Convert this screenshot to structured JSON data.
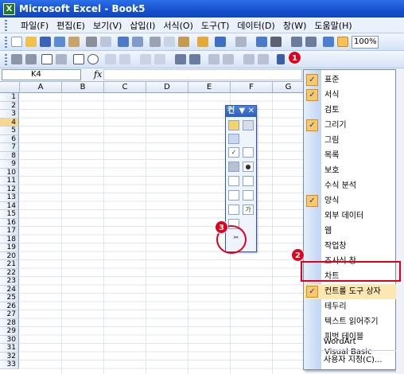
{
  "app": {
    "title": "Microsoft Excel - Book5",
    "icon": "excel-icon"
  },
  "menubar": {
    "items": [
      "파일(F)",
      "편집(E)",
      "보기(V)",
      "삽입(I)",
      "서식(O)",
      "도구(T)",
      "데이터(D)",
      "창(W)",
      "도움말(H)"
    ]
  },
  "toolbar": {
    "zoom": "100%"
  },
  "formula": {
    "name_box": "K4",
    "fx": "fx"
  },
  "columns": [
    "A",
    "B",
    "C",
    "D",
    "E",
    "F",
    "G"
  ],
  "rows": [
    "1",
    "2",
    "3",
    "4",
    "5",
    "6",
    "7",
    "8",
    "9",
    "10",
    "11",
    "12",
    "13",
    "14",
    "15",
    "16",
    "17",
    "18",
    "19",
    "20",
    "21",
    "22",
    "23",
    "24",
    "25",
    "26",
    "27",
    "28",
    "29",
    "30",
    "31",
    "32",
    "33"
  ],
  "control_toolbox": {
    "title": "컨",
    "title_controls": "▼ ✕",
    "button_ga": "가"
  },
  "dropdown": {
    "items": [
      {
        "label": "표준",
        "checked": true
      },
      {
        "label": "서식",
        "checked": true
      },
      {
        "label": "검토",
        "checked": false
      },
      {
        "label": "그리기",
        "checked": true
      },
      {
        "label": "그림",
        "checked": false
      },
      {
        "label": "목록",
        "checked": false
      },
      {
        "label": "보호",
        "checked": false
      },
      {
        "label": "수식 분석",
        "checked": false
      },
      {
        "label": "양식",
        "checked": true
      },
      {
        "label": "외부 데이터",
        "checked": false
      },
      {
        "label": "웹",
        "checked": false
      },
      {
        "label": "작업창",
        "checked": false
      },
      {
        "label": "조사식 창",
        "checked": false
      },
      {
        "label": "차트",
        "checked": false
      },
      {
        "label": "컨트롤 도구 상자",
        "checked": true
      },
      {
        "label": "테두리",
        "checked": false
      },
      {
        "label": "텍스트 읽어주기",
        "checked": false
      },
      {
        "label": "피벗 테이블",
        "checked": false
      },
      {
        "label": "Visual Basic",
        "checked": false
      },
      {
        "label": "WordArt",
        "checked": false
      },
      {
        "label": "사용자 지정(C)...",
        "checked": false
      }
    ]
  },
  "annotations": {
    "step1": "1",
    "step2": "2",
    "step3": "3"
  },
  "colors": {
    "highlight": "#e0001b",
    "title_bar": "#1550cc"
  }
}
